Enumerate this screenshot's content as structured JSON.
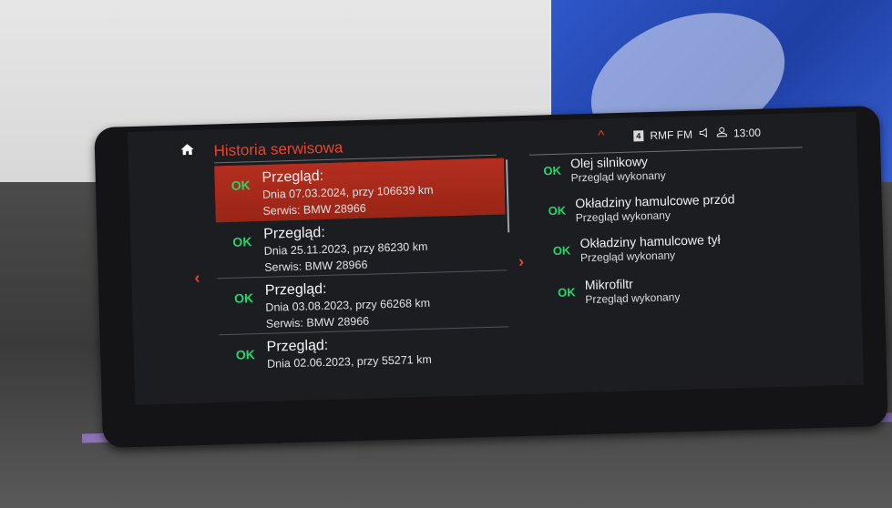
{
  "header": {
    "title": "Historia serwisowa",
    "up_chevron": "^",
    "station_number": "4",
    "station_name": "RMF FM",
    "time": "13:00"
  },
  "icons": {
    "home": "home-icon",
    "speaker": "speaker-icon",
    "user": "user-profile-icon",
    "left_arrow": "‹",
    "right_arrow": "›"
  },
  "history": [
    {
      "status": "OK",
      "title": "Przegląd:",
      "detail": "Dnia 07.03.2024, przy 106639 km",
      "service": "Serwis: BMW 28966",
      "selected": true
    },
    {
      "status": "OK",
      "title": "Przegląd:",
      "detail": "Dnia 25.11.2023, przy 86230 km",
      "service": "Serwis: BMW 28966",
      "selected": false
    },
    {
      "status": "OK",
      "title": "Przegląd:",
      "detail": "Dnia 03.08.2023, przy 66268 km",
      "service": "Serwis: BMW 28966",
      "selected": false
    },
    {
      "status": "OK",
      "title": "Przegląd:",
      "detail": "Dnia 02.06.2023, przy 55271 km",
      "service": "",
      "selected": false
    }
  ],
  "checks": [
    {
      "status": "OK",
      "name": "Olej silnikowy",
      "sub": "Przegląd wykonany"
    },
    {
      "status": "OK",
      "name": "Okładziny hamulcowe przód",
      "sub": "Przegląd wykonany"
    },
    {
      "status": "OK",
      "name": "Okładziny hamulcowe tył",
      "sub": "Przegląd wykonany"
    },
    {
      "status": "OK",
      "name": "Mikrofiltr",
      "sub": "Przegląd wykonany"
    }
  ],
  "colors": {
    "accent": "#e8452d",
    "ok": "#22d66a",
    "selected_row": "#b42e1f"
  }
}
